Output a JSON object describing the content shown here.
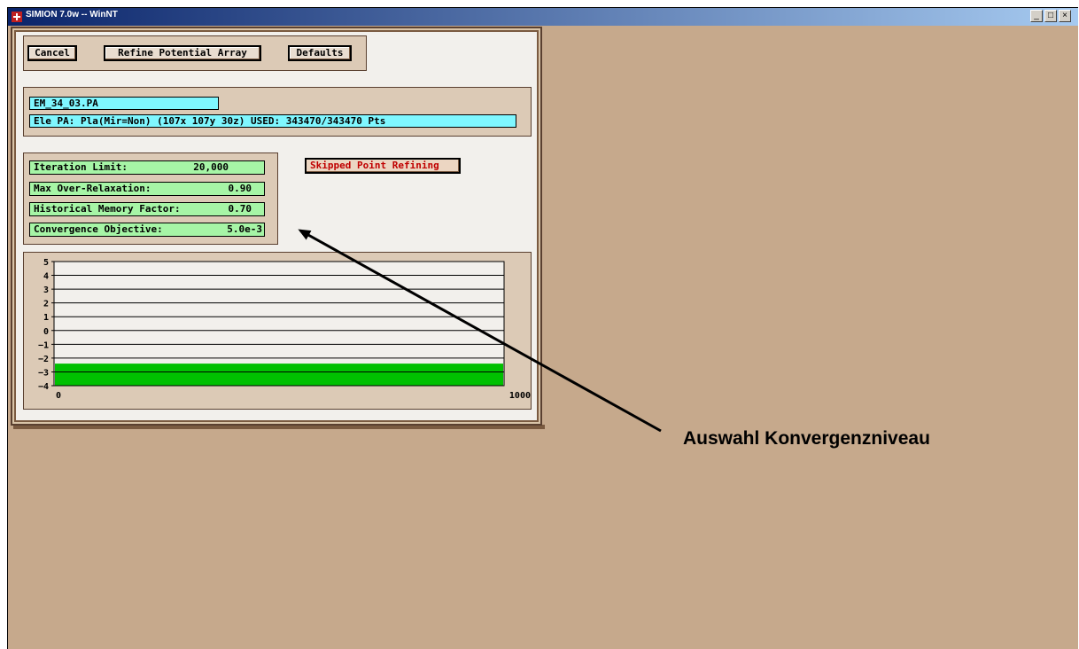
{
  "window": {
    "title": "SIMION 7.0w -- WinNT",
    "controls": [
      "_",
      "□",
      "×"
    ]
  },
  "buttons": {
    "cancel": "Cancel",
    "refine": "Refine Potential Array",
    "defaults": "Defaults",
    "skipped": "Skipped Point Refining"
  },
  "pa": {
    "filename": "EM_34_03.PA",
    "info": "Ele PA: Pla(Mir=Non) (107x 107y 30z)  USED: 343470/343470 Pts"
  },
  "params": [
    {
      "label": "Iteration Limit:",
      "value": "20,000"
    },
    {
      "label": "Max Over-Relaxation:",
      "value": "0.90"
    },
    {
      "label": "Historical Memory Factor:",
      "value": "0.70"
    },
    {
      "label": "Convergence Objective:",
      "value": "5.0e-3"
    }
  ],
  "chart_data": {
    "type": "bar",
    "yticks": [
      "5",
      "4",
      "3",
      "2",
      "1",
      "0",
      "-1",
      "-2",
      "-3",
      "-4"
    ],
    "xticks": [
      "0",
      "1000"
    ],
    "ylim": [
      -4,
      5
    ],
    "xlim": [
      0,
      1000
    ],
    "fill_color": "#00c000",
    "fill_range": [
      -4,
      -2.4
    ],
    "grid": true
  },
  "annotation": {
    "text": "Auswahl Konvergenzniveau"
  }
}
